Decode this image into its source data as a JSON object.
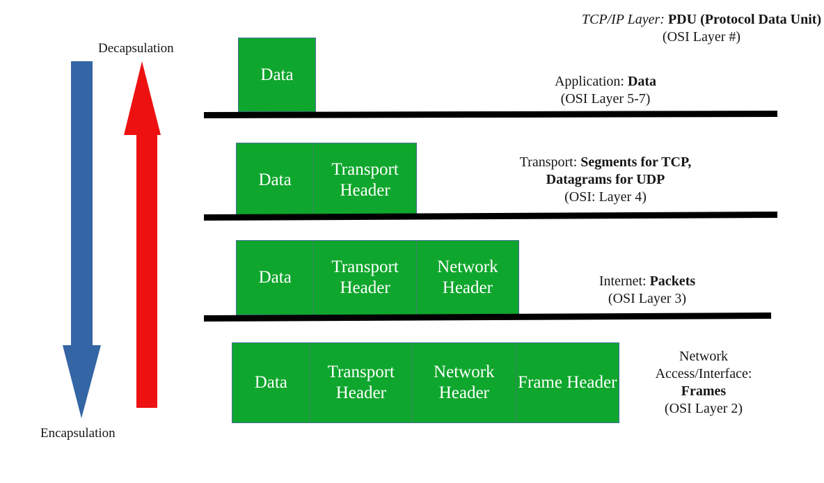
{
  "header": {
    "line1_italic": "TCP/IP Layer:",
    "line1_bold": "PDU (Protocol Data Unit)",
    "line2": "(OSI Layer #)"
  },
  "arrows": {
    "up": {
      "caption": "Decapsulation",
      "color": "#EE1111",
      "direction": "up"
    },
    "down": {
      "caption": "Encapsulation",
      "color": "#3465A4",
      "direction": "down"
    }
  },
  "colors": {
    "pdu_fill": "#0FA62D",
    "pdu_border": "#4A6F9A",
    "bar": "#000000",
    "text": "#161616"
  },
  "layers": [
    {
      "id": "application",
      "name": "Application:",
      "pdu": "Data",
      "osi": "(OSI Layer 5-7)",
      "cells": [
        "Data"
      ]
    },
    {
      "id": "transport",
      "name": "Transport:",
      "pdu": "Segments for TCP,",
      "pdu_line2": "Datagrams for UDP",
      "osi": "(OSI: Layer 4)",
      "cells": [
        "Data",
        "Transport Header"
      ]
    },
    {
      "id": "internet",
      "name": "Internet:",
      "pdu": "Packets",
      "osi": "(OSI Layer 3)",
      "cells": [
        "Data",
        "Transport Header",
        "Network Header"
      ]
    },
    {
      "id": "network-access",
      "name_line1": "Network",
      "name_line2": "Access/Interface:",
      "pdu": "Frames",
      "osi": "(OSI Layer 2)",
      "cells": [
        "Data",
        "Transport Header",
        "Network Header",
        "Frame Header"
      ]
    }
  ]
}
